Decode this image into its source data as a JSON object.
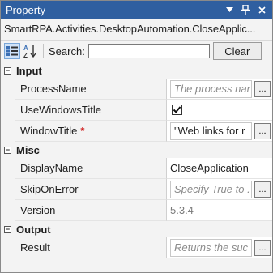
{
  "panel": {
    "title": "Property",
    "type_name": "SmartRPA.Activities.DesktopAutomation.CloseApplic...",
    "title_buttons": [
      "chevron-down-icon",
      "pin-icon",
      "close-icon"
    ]
  },
  "toolbar": {
    "search_label": "Search:",
    "search_value": "",
    "clear_label": "Clear",
    "sort_icons": [
      "categorized-view-icon",
      "alphabetical-sort-icon"
    ]
  },
  "sections": {
    "input": {
      "label": "Input",
      "toggle": "−",
      "process_name": {
        "label": "ProcessName",
        "placeholder": "The process nar",
        "button": "..."
      },
      "use_windows_title": {
        "label": "UseWindowsTitle",
        "checked": true
      },
      "window_title": {
        "label": "WindowTitle",
        "required": "*",
        "value": "\"Web links for r",
        "button": "..."
      }
    },
    "misc": {
      "label": "Misc",
      "toggle": "−",
      "display_name": {
        "label": "DisplayName",
        "value": "CloseApplication"
      },
      "skip_on_error": {
        "label": "SkipOnError",
        "placeholder": "Specify True to .",
        "button": "..."
      },
      "version": {
        "label": "Version",
        "value": "5.3.4"
      }
    },
    "output": {
      "label": "Output",
      "toggle": "−",
      "result": {
        "label": "Result",
        "placeholder": "Returns the suc",
        "button": "..."
      }
    }
  },
  "colors": {
    "titlebar": "#2f5fa0",
    "required": "#d02020",
    "placeholder": "#8c8c8c"
  }
}
